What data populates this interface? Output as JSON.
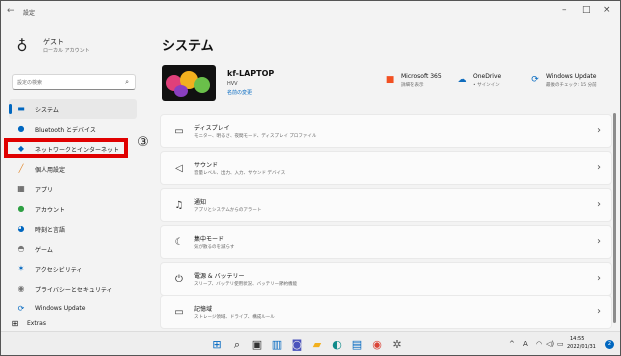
{
  "app": {
    "title": "設定",
    "back_glyph": "←",
    "minimize": "–",
    "maximize": "□",
    "close": "×"
  },
  "user": {
    "name": "ゲスト",
    "sub": "ローカル アカウント",
    "avatar_glyph": "♁"
  },
  "search": {
    "placeholder": "設定の検索",
    "icon_glyph": "⌕"
  },
  "sidebar": {
    "items": [
      {
        "label": "システム",
        "icon": "monitor-icon",
        "glyph": "▬",
        "color": "#0067c0"
      },
      {
        "label": "Bluetooth とデバイス",
        "icon": "bluetooth-icon",
        "glyph": "●",
        "color": "#0067c0"
      },
      {
        "label": "ネットワークとインターネット",
        "icon": "wifi-icon",
        "glyph": "◆",
        "color": "#0067c0"
      },
      {
        "label": "個人用設定",
        "icon": "brush-icon",
        "glyph": "╱",
        "color": "#e0862b"
      },
      {
        "label": "アプリ",
        "icon": "apps-icon",
        "glyph": "▦",
        "color": "#444444"
      },
      {
        "label": "アカウント",
        "icon": "person-icon",
        "glyph": "●",
        "color": "#2ea043"
      },
      {
        "label": "時刻と言語",
        "icon": "globe-icon",
        "glyph": "◕",
        "color": "#0067c0"
      },
      {
        "label": "ゲーム",
        "icon": "gamepad-icon",
        "glyph": "◓",
        "color": "#777777"
      },
      {
        "label": "アクセシビリティ",
        "icon": "accessibility-icon",
        "glyph": "✶",
        "color": "#0067c0"
      },
      {
        "label": "プライバシーとセキュリティ",
        "icon": "shield-icon",
        "glyph": "◉",
        "color": "#777777"
      },
      {
        "label": "Windows Update",
        "icon": "update-icon",
        "glyph": "⟳",
        "color": "#0067c0"
      },
      {
        "label": "Extras",
        "icon": "extras-icon",
        "glyph": "⊞",
        "color": "#444444"
      }
    ]
  },
  "annotation": {
    "step": "③",
    "color": "#e00000"
  },
  "main": {
    "title": "システム",
    "device": {
      "name": "kf-LAPTOP",
      "model": "HVV",
      "rename": "名前の変更"
    },
    "quick": [
      {
        "title": "Microsoft 365",
        "sub": "詳細を表示",
        "icon": "microsoft-icon",
        "glyph": "■",
        "color": "#f25022"
      },
      {
        "title": "OneDrive",
        "sub": "• サインイン",
        "icon": "cloud-icon",
        "glyph": "☁",
        "color": "#0f6cbd"
      },
      {
        "title": "Windows Update",
        "sub": "最後のチェック: 15 分前",
        "icon": "update-icon",
        "glyph": "⟳",
        "color": "#0067c0"
      }
    ],
    "rows": [
      {
        "title": "ディスプレイ",
        "sub": "モニター、明るさ、夜間モード、ディスプレイ プロファイル",
        "icon": "display-icon",
        "glyph": "▭"
      },
      {
        "title": "サウンド",
        "sub": "音量レベル、出力、入力、サウンド デバイス",
        "icon": "speaker-icon",
        "glyph": "◁"
      },
      {
        "title": "通知",
        "sub": "アプリとシステムからのアラート",
        "icon": "bell-icon",
        "glyph": "♫"
      },
      {
        "title": "集中モード",
        "sub": "気が散るのを減らす",
        "icon": "moon-icon",
        "glyph": "☾"
      },
      {
        "title": "電源 & バッテリー",
        "sub": "スリープ、バッテリ使用状況、バッテリー節約機能",
        "icon": "power-icon",
        "glyph": "⏻"
      },
      {
        "title": "記憶域",
        "sub": "ストレージ領域、ドライブ、構成ルール",
        "icon": "storage-icon",
        "glyph": "▭"
      }
    ],
    "chevron": "›"
  },
  "taskbar": {
    "icons": [
      {
        "name": "start-icon",
        "glyph": "⊞",
        "color": "#0067c0"
      },
      {
        "name": "search-icon",
        "glyph": "⌕",
        "color": "#222222"
      },
      {
        "name": "task-view-icon",
        "glyph": "▣",
        "color": "#333333"
      },
      {
        "name": "widgets-icon",
        "glyph": "▥",
        "color": "#0067c0"
      },
      {
        "name": "chat-icon",
        "glyph": "◙",
        "color": "#4b53bc"
      },
      {
        "name": "explorer-icon",
        "glyph": "▰",
        "color": "#f2b01e"
      },
      {
        "name": "edge-icon",
        "glyph": "◐",
        "color": "#0f8a8a"
      },
      {
        "name": "store-icon",
        "glyph": "▤",
        "color": "#0067c0"
      },
      {
        "name": "chrome-icon",
        "glyph": "◉",
        "color": "#db4437"
      },
      {
        "name": "settings-icon",
        "glyph": "✲",
        "color": "#555555"
      }
    ],
    "tray_chevron": "^",
    "ime": "A",
    "wifi": "◠",
    "volume": "◁)",
    "battery": "▭",
    "time": "14:55",
    "date": "2022/01/31",
    "notifications": "2"
  }
}
